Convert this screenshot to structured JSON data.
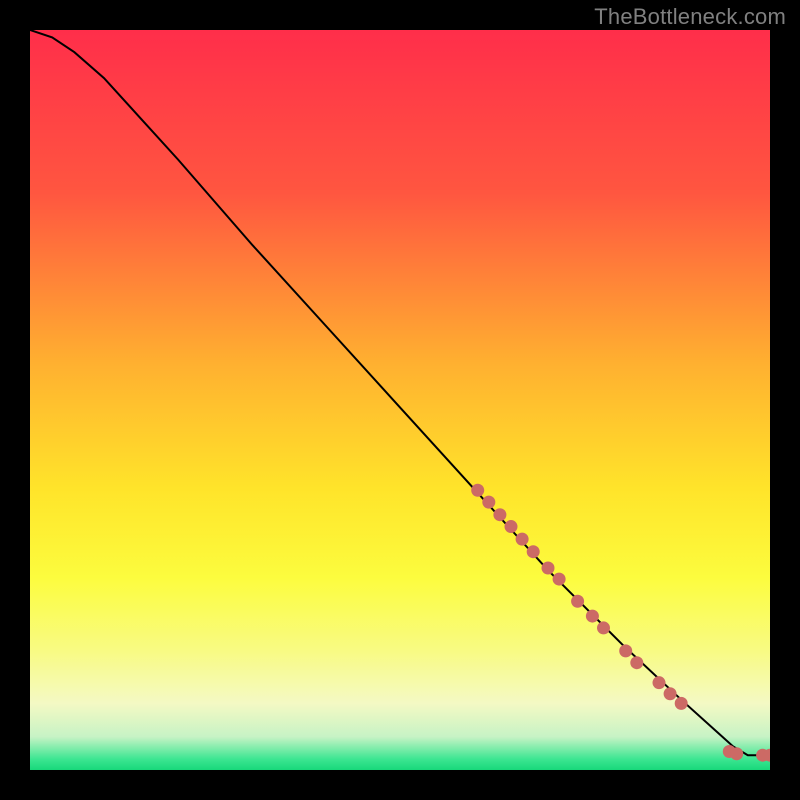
{
  "watermark": "TheBottleneck.com",
  "colors": {
    "frame": "#000000",
    "watermark_text": "#808080",
    "curve": "#000000",
    "marker_fill": "#CC6A65",
    "gradient_stops": [
      {
        "offset": 0.0,
        "color": "#FF2E4A"
      },
      {
        "offset": 0.22,
        "color": "#FF5640"
      },
      {
        "offset": 0.45,
        "color": "#FFB030"
      },
      {
        "offset": 0.62,
        "color": "#FFE42A"
      },
      {
        "offset": 0.74,
        "color": "#FCFC3E"
      },
      {
        "offset": 0.84,
        "color": "#F8FB84"
      },
      {
        "offset": 0.91,
        "color": "#F4F9C4"
      },
      {
        "offset": 0.955,
        "color": "#C7F3C5"
      },
      {
        "offset": 0.985,
        "color": "#3DE692"
      },
      {
        "offset": 1.0,
        "color": "#18D87A"
      }
    ]
  },
  "chart_data": {
    "type": "line",
    "title": "",
    "xlabel": "",
    "ylabel": "",
    "xlim": [
      0,
      100
    ],
    "ylim": [
      0,
      100
    ],
    "series": [
      {
        "name": "curve",
        "x": [
          0,
          3,
          6,
          10,
          15,
          20,
          30,
          40,
          50,
          60,
          70,
          80,
          88,
          93,
          95,
          97,
          100
        ],
        "y": [
          100,
          99,
          97,
          93.5,
          88,
          82.5,
          71,
          60,
          49,
          38,
          27,
          17,
          9.5,
          5,
          3.2,
          2,
          2
        ]
      }
    ],
    "markers": {
      "segment_points": [
        {
          "x": 60.5,
          "y": 37.8
        },
        {
          "x": 62.0,
          "y": 36.2
        },
        {
          "x": 63.5,
          "y": 34.5
        },
        {
          "x": 65.0,
          "y": 32.9
        },
        {
          "x": 66.5,
          "y": 31.2
        },
        {
          "x": 68.0,
          "y": 29.5
        },
        {
          "x": 70.0,
          "y": 27.3
        },
        {
          "x": 71.5,
          "y": 25.8
        },
        {
          "x": 74.0,
          "y": 22.8
        },
        {
          "x": 76.0,
          "y": 20.8
        },
        {
          "x": 77.5,
          "y": 19.2
        },
        {
          "x": 80.5,
          "y": 16.1
        },
        {
          "x": 82.0,
          "y": 14.5
        },
        {
          "x": 85.0,
          "y": 11.8
        },
        {
          "x": 86.5,
          "y": 10.3
        },
        {
          "x": 88.0,
          "y": 9.0
        }
      ],
      "tail_points": [
        {
          "x": 94.5,
          "y": 2.5
        },
        {
          "x": 95.5,
          "y": 2.2
        },
        {
          "x": 99.0,
          "y": 2.0
        },
        {
          "x": 100.0,
          "y": 2.0
        }
      ],
      "radius": 6.5
    }
  }
}
